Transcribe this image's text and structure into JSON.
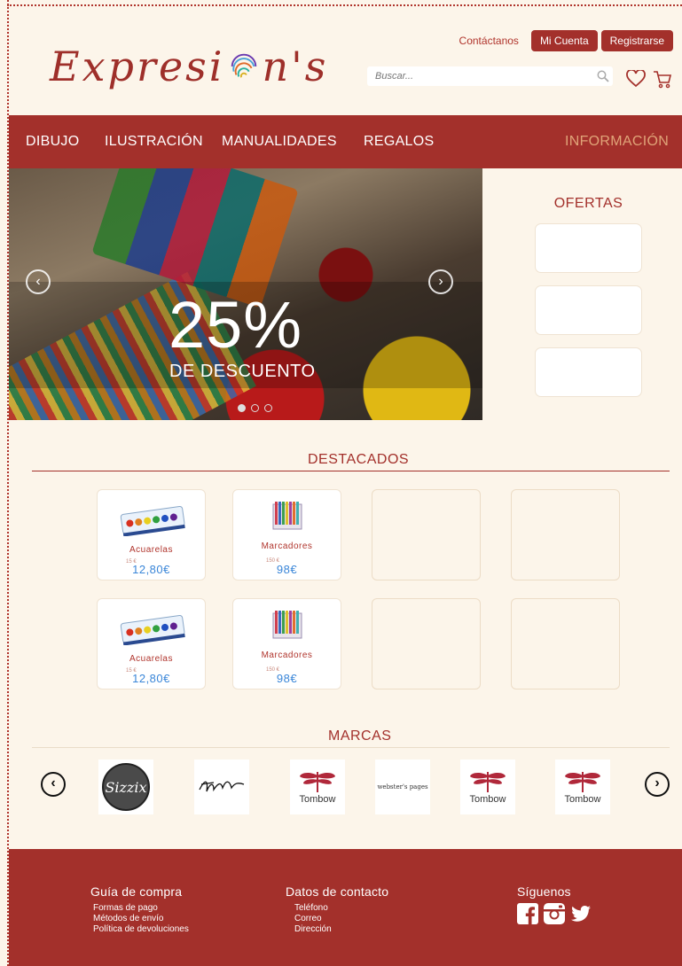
{
  "header": {
    "logo_text_left": "Expresi",
    "logo_text_right": "n's",
    "contact_label": "Contáctanos",
    "account_label": "Mi Cuenta",
    "register_label": "Registrarse",
    "search_placeholder": "Buscar..."
  },
  "nav": {
    "items": [
      "DIBUJO",
      "ILUSTRACIÓN",
      "MANUALIDADES",
      "REGALOS"
    ],
    "info_label": "INFORMACIÓN"
  },
  "hero": {
    "headline": "25%",
    "subheadline": "DE DESCUENTO",
    "slides_count": 3,
    "active_slide": 1
  },
  "offers": {
    "title": "OFERTAS"
  },
  "featured": {
    "title": "DESTACADOS",
    "products": [
      {
        "name": "Acuarelas",
        "old_price": "15 €",
        "price": "12,80€"
      },
      {
        "name": "Marcadores",
        "old_price": "150 €",
        "price": "98€"
      },
      {
        "name": "Acuarelas",
        "old_price": "15 €",
        "price": "12,80€"
      },
      {
        "name": "Marcadores",
        "old_price": "150 €",
        "price": "98€"
      }
    ]
  },
  "brands": {
    "title": "MARCAS",
    "items": [
      {
        "name": "Sizzix"
      },
      {
        "name": "Tim Holtz"
      },
      {
        "name": "Tombow"
      },
      {
        "name": "webster's pages"
      },
      {
        "name": "Tombow"
      },
      {
        "name": "Tombow"
      }
    ]
  },
  "footer": {
    "guide": {
      "title": "Guía de compra",
      "links": [
        "Formas de pago",
        "Métodos de envío",
        "Política de devoluciones"
      ]
    },
    "contact": {
      "title": "Datos de contacto",
      "links": [
        "Teléfono",
        "Correo",
        "Dirección"
      ]
    },
    "social": {
      "title": "Síguenos",
      "icons": [
        "facebook-icon",
        "instagram-icon",
        "twitter-icon"
      ]
    }
  },
  "colors": {
    "brand": "#a3302b",
    "background": "#fcf5ea",
    "accent_info": "#e0a478",
    "price": "#3a86d8"
  }
}
